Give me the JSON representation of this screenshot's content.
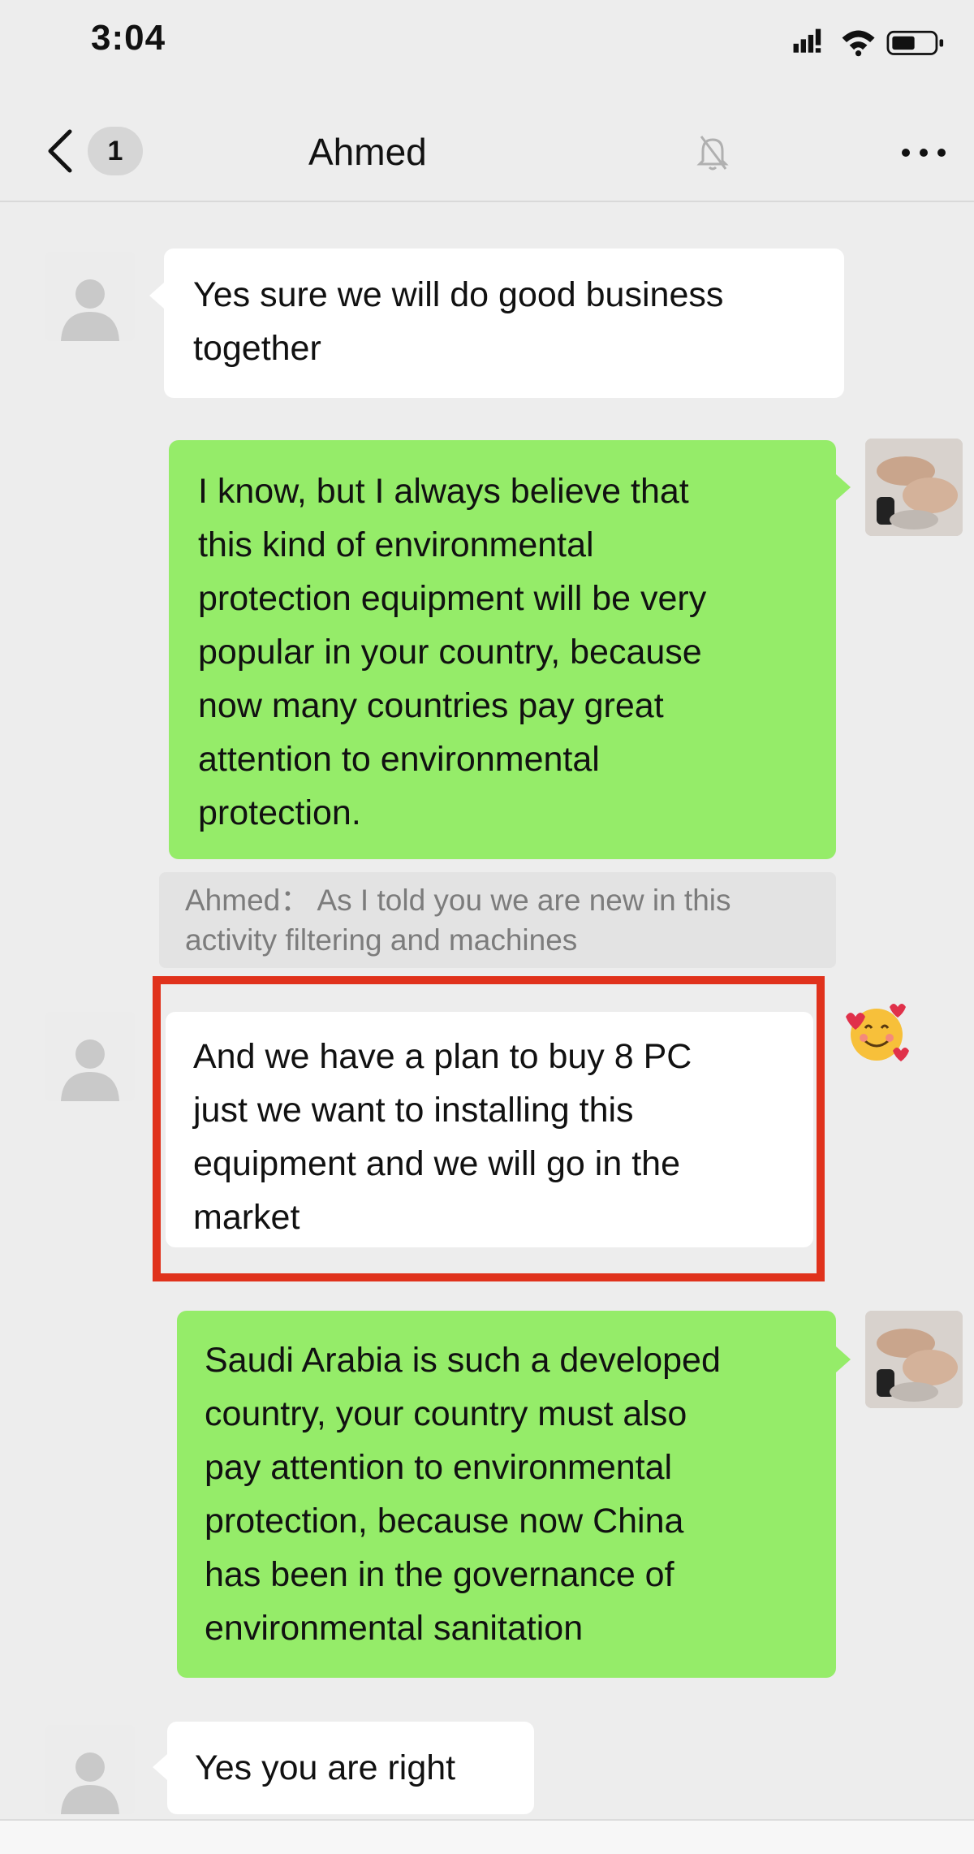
{
  "status_bar": {
    "time": "3:04",
    "icons": [
      "signal-icon",
      "wifi-icon",
      "battery-icon"
    ]
  },
  "nav": {
    "back_icon": "chevron-left-icon",
    "unread_count": "1",
    "title": "Ahmed",
    "mute_icon": "bell-muted-icon",
    "more_icon": "more-dots-icon"
  },
  "messages": [
    {
      "sender": "contact",
      "avatar": "default-avatar-icon",
      "lines": [
        "Yes sure we will do good business",
        "together"
      ]
    },
    {
      "sender": "me",
      "avatar": "photo-avatar",
      "lines": [
        "I know, but I always believe that",
        "this kind of environmental",
        "protection equipment will be very",
        "popular in your country, because",
        "now many countries pay great",
        "attention to environmental",
        "protection."
      ],
      "quote": {
        "lines": [
          "Ahmed：  As I told you we are new in this",
          "activity filtering and machines"
        ]
      }
    },
    {
      "sender": "contact",
      "avatar": "default-avatar-icon",
      "highlighted": true,
      "reaction": "smiling-face-with-hearts-emoji",
      "lines": [
        "And we have a plan to buy 8 PC",
        "just we want to installing this",
        "equipment and we will go in the",
        "market"
      ]
    },
    {
      "sender": "me",
      "avatar": "photo-avatar",
      "lines": [
        "Saudi Arabia is such a developed",
        "country, your country must also",
        "pay attention to environmental",
        "protection, because now China",
        "has been in the governance of",
        "environmental sanitation"
      ]
    },
    {
      "sender": "contact",
      "avatar": "default-avatar-icon",
      "lines": [
        "Yes you are right"
      ]
    }
  ],
  "colors": {
    "background": "#ededed",
    "bubble_out": "#95ec69",
    "bubble_in": "#ffffff",
    "highlight": "#e0321c"
  }
}
